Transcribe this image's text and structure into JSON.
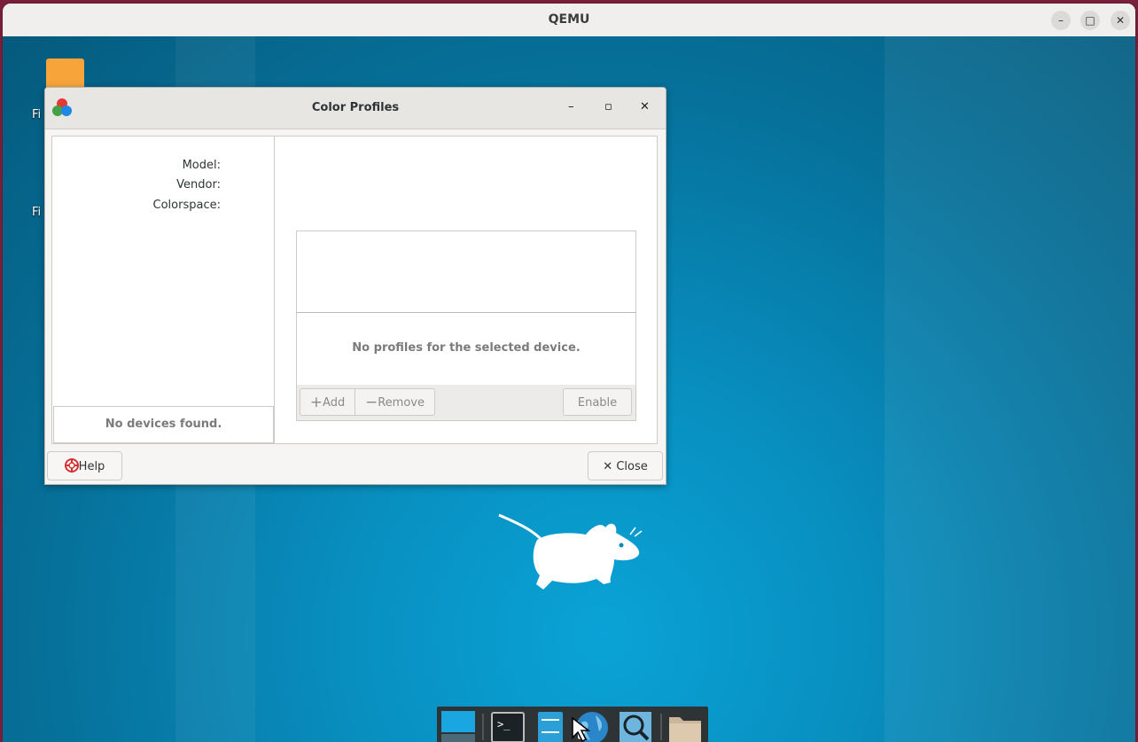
{
  "qemu": {
    "title": "QEMU",
    "minimize": "–",
    "maximize": "□",
    "close": "✕"
  },
  "desktop": {
    "icon_label_1": "Fi",
    "icon_label_2": "Fi"
  },
  "dialog": {
    "title": "Color Profiles",
    "minimize": "–",
    "maximize": "▫",
    "close": "✕",
    "devices": {
      "empty_text": "No devices found."
    },
    "info": {
      "model_label": "Model:",
      "vendor_label": "Vendor:",
      "colorspace_label": "Colorspace:"
    },
    "profiles": {
      "empty_text": "No profiles for the selected device.",
      "add_label": "Add",
      "remove_label": "Remove",
      "enable_label": "Enable"
    },
    "help_label": "Help",
    "close_label": "Close"
  },
  "colors": {
    "desktop_accent": "#088fc0",
    "disabled_text": "#7b7b7b"
  },
  "dock": {
    "items": [
      "workspace-icon",
      "terminal-icon",
      "file-manager-icon",
      "web-browser-icon",
      "app-finder-icon",
      "folder-icon"
    ]
  }
}
